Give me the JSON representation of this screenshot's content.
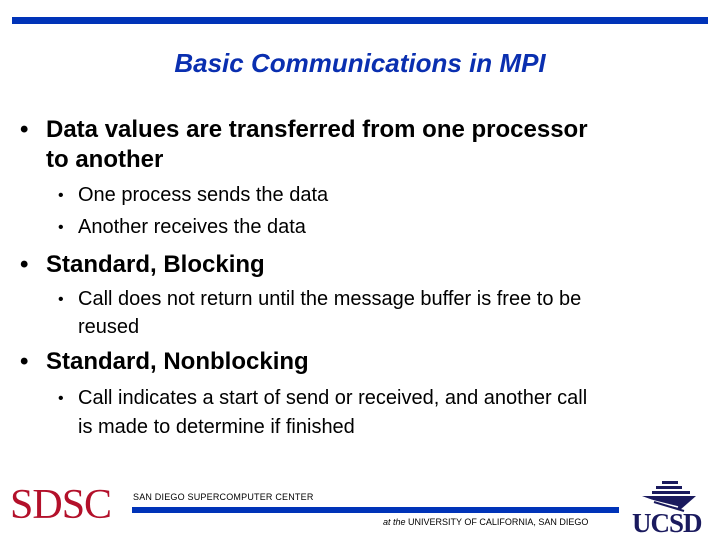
{
  "slide": {
    "title": "Basic Communications in MPI",
    "bullets": [
      {
        "text_line1": "Data values are transferred from one processor",
        "text_line2": "to another",
        "sub": [
          "One process sends the data",
          "Another receives the data"
        ]
      },
      {
        "text": "Standard, Blocking",
        "sub_line1": "Call does not return until the message buffer is free to be",
        "sub_line2": "reused"
      },
      {
        "text": "Standard, Nonblocking",
        "sub_line1": "Call indicates a start of send or received, and another call",
        "sub_line2": "is made to determine if finished"
      }
    ],
    "bullet_glyph": "•"
  },
  "footer": {
    "sdsc_logo": "SDSC",
    "sdsc_name": "SAN DIEGO SUPERCOMPUTER CENTER",
    "affil_prefix": "at the",
    "affil_name": "UNIVERSITY OF CALIFORNIA, SAN DIEGO",
    "ucsd_logo": "UCSD",
    "ucsd_emblem_icon": "ucsd-triton-emblem-icon"
  },
  "colors": {
    "accent_blue": "#0033b8",
    "title_blue": "#0a2fb0",
    "sdsc_red": "#b3102a",
    "ucsd_navy": "#1a1a5e"
  }
}
